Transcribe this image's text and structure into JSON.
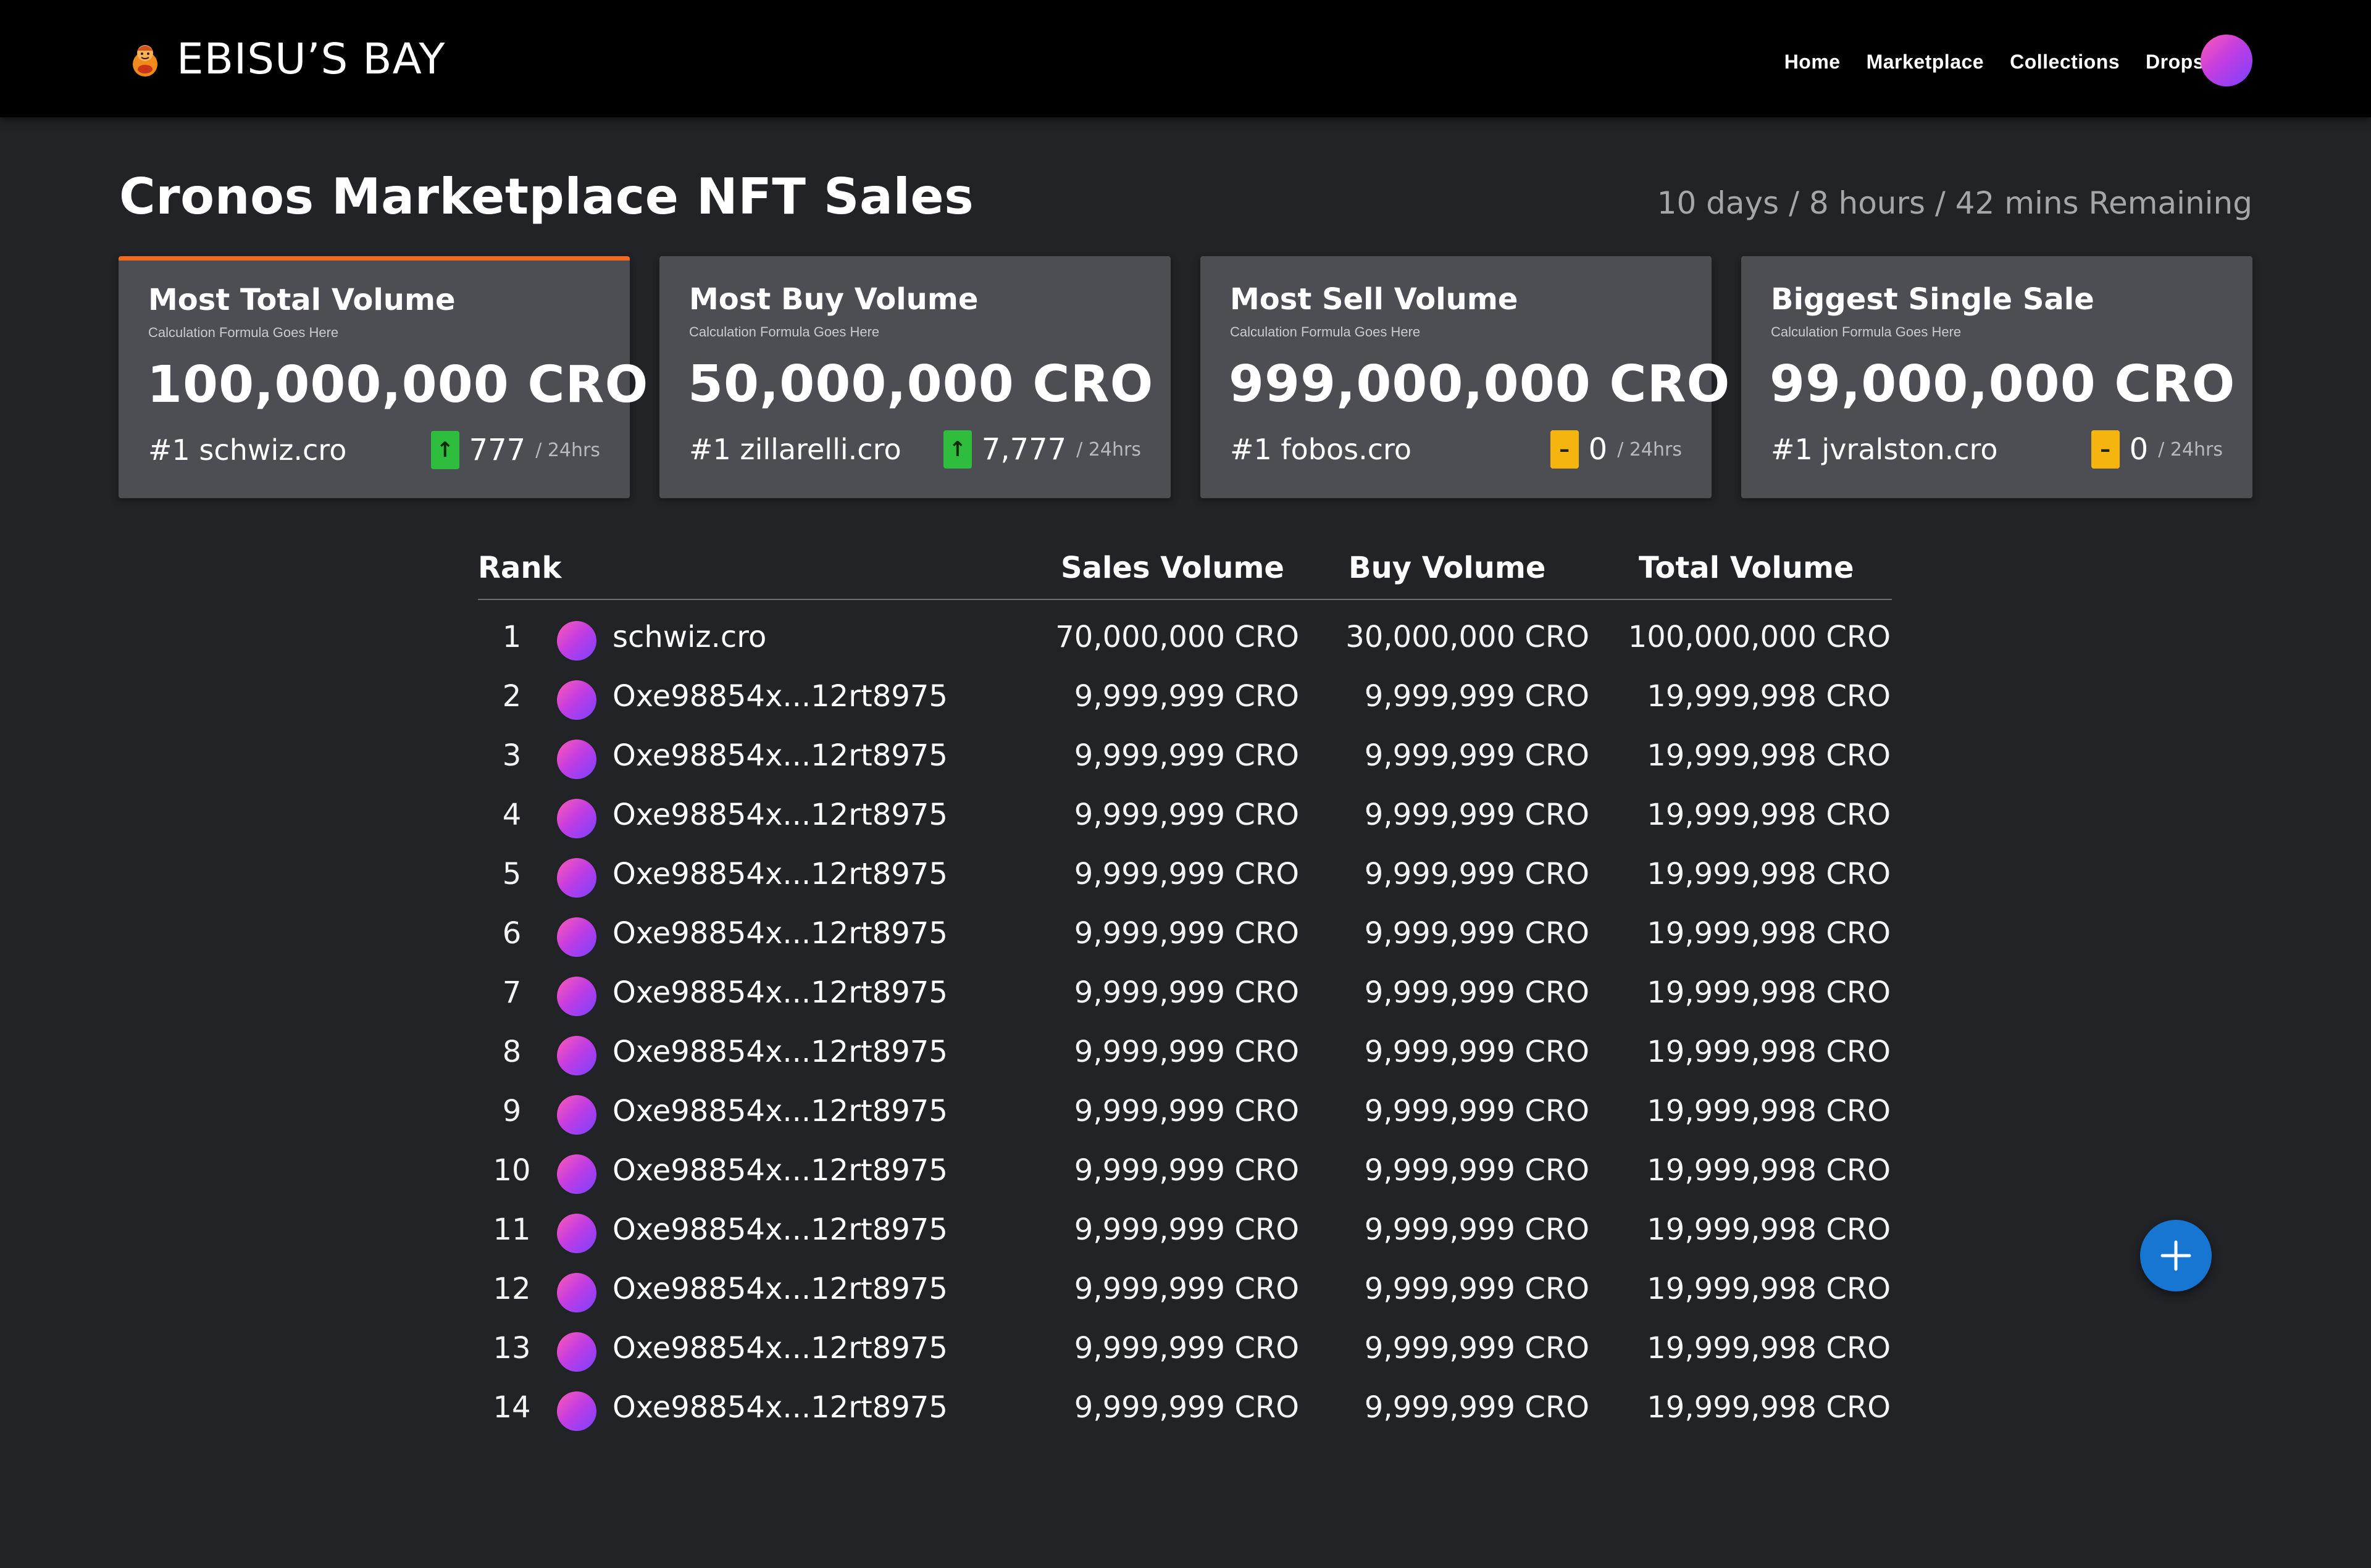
{
  "nav": {
    "brand": "EBISU’S BAY",
    "links": [
      "Home",
      "Marketplace",
      "Collections",
      "Drops"
    ]
  },
  "header": {
    "title": "Cronos Marketplace NFT Sales",
    "time_remaining": "10 days / 8 hours / 42 mins Remaining"
  },
  "cards": [
    {
      "title": "Most Total Volume",
      "subtitle": "Calculation Formula Goes Here",
      "value": "100,000,000 CRO",
      "leader": "#1 schwiz.cro",
      "change": "777",
      "period": "/ 24hrs",
      "trend": "up"
    },
    {
      "title": "Most Buy Volume",
      "subtitle": "Calculation Formula Goes Here",
      "value": "50,000,000 CRO",
      "leader": "#1 zillarelli.cro",
      "change": "7,777",
      "period": "/ 24hrs",
      "trend": "up"
    },
    {
      "title": "Most Sell Volume",
      "subtitle": "Calculation Formula Goes Here",
      "value": "999,000,000 CRO",
      "leader": "#1 fobos.cro",
      "change": "0",
      "period": "/ 24hrs",
      "trend": "flat"
    },
    {
      "title": "Biggest Single Sale",
      "subtitle": "Calculation Formula Goes Here",
      "value": "99,000,000 CRO",
      "leader": "#1 jvralston.cro",
      "change": "0",
      "period": "/ 24hrs",
      "trend": "flat"
    }
  ],
  "table": {
    "headers": {
      "rank": "Rank",
      "sales": "Sales Volume",
      "buy": "Buy Volume",
      "total": "Total Volume"
    },
    "rows": [
      {
        "rank": "1",
        "name": "schwiz.cro",
        "sales": "70,000,000 CRO",
        "buy": "30,000,000 CRO",
        "total": "100,000,000 CRO"
      },
      {
        "rank": "2",
        "name": "Oxe98854x...12rt8975",
        "sales": "9,999,999 CRO",
        "buy": "9,999,999 CRO",
        "total": "19,999,998 CRO"
      },
      {
        "rank": "3",
        "name": "Oxe98854x...12rt8975",
        "sales": "9,999,999 CRO",
        "buy": "9,999,999 CRO",
        "total": "19,999,998 CRO"
      },
      {
        "rank": "4",
        "name": "Oxe98854x...12rt8975",
        "sales": "9,999,999 CRO",
        "buy": "9,999,999 CRO",
        "total": "19,999,998 CRO"
      },
      {
        "rank": "5",
        "name": "Oxe98854x...12rt8975",
        "sales": "9,999,999 CRO",
        "buy": "9,999,999 CRO",
        "total": "19,999,998 CRO"
      },
      {
        "rank": "6",
        "name": "Oxe98854x...12rt8975",
        "sales": "9,999,999 CRO",
        "buy": "9,999,999 CRO",
        "total": "19,999,998 CRO"
      },
      {
        "rank": "7",
        "name": "Oxe98854x...12rt8975",
        "sales": "9,999,999 CRO",
        "buy": "9,999,999 CRO",
        "total": "19,999,998 CRO"
      },
      {
        "rank": "8",
        "name": "Oxe98854x...12rt8975",
        "sales": "9,999,999 CRO",
        "buy": "9,999,999 CRO",
        "total": "19,999,998 CRO"
      },
      {
        "rank": "9",
        "name": "Oxe98854x...12rt8975",
        "sales": "9,999,999 CRO",
        "buy": "9,999,999 CRO",
        "total": "19,999,998 CRO"
      },
      {
        "rank": "10",
        "name": "Oxe98854x...12rt8975",
        "sales": "9,999,999 CRO",
        "buy": "9,999,999 CRO",
        "total": "19,999,998 CRO"
      },
      {
        "rank": "11",
        "name": "Oxe98854x...12rt8975",
        "sales": "9,999,999 CRO",
        "buy": "9,999,999 CRO",
        "total": "19,999,998 CRO"
      },
      {
        "rank": "12",
        "name": "Oxe98854x...12rt8975",
        "sales": "9,999,999 CRO",
        "buy": "9,999,999 CRO",
        "total": "19,999,998 CRO"
      },
      {
        "rank": "13",
        "name": "Oxe98854x...12rt8975",
        "sales": "9,999,999 CRO",
        "buy": "9,999,999 CRO",
        "total": "19,999,998 CRO"
      },
      {
        "rank": "14",
        "name": "Oxe98854x...12rt8975",
        "sales": "9,999,999 CRO",
        "buy": "9,999,999 CRO",
        "total": "19,999,998 CRO"
      }
    ]
  },
  "icons": {
    "logo": "ebisu-lucky-god-icon",
    "trend_up": "arrow-up-icon",
    "trend_flat": "minus-icon",
    "fab": "plus-icon"
  },
  "colors": {
    "background": "#212327",
    "navbar": "#000000",
    "card": "#4c4e53",
    "accent": "#f5691c",
    "trend_up": "#2fbd3d",
    "trend_flat": "#f6b40e",
    "fab": "#1676d2"
  }
}
